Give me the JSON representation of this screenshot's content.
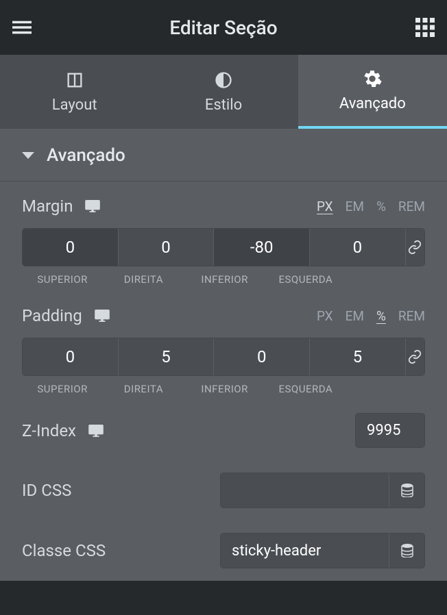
{
  "header": {
    "title": "Editar Seção"
  },
  "tabs": [
    {
      "label": "Layout"
    },
    {
      "label": "Estilo"
    },
    {
      "label": "Avançado"
    }
  ],
  "section": {
    "title": "Avançado"
  },
  "margin": {
    "label": "Margin",
    "units": {
      "px": "PX",
      "em": "EM",
      "pct": "%",
      "rem": "REM"
    },
    "top": "0",
    "right": "0",
    "bottom": "-80",
    "left": "0",
    "sublabels": {
      "top": "SUPERIOR",
      "right": "DIREITA",
      "bottom": "INFERIOR",
      "left": "ESQUERDA"
    }
  },
  "padding": {
    "label": "Padding",
    "units": {
      "px": "PX",
      "em": "EM",
      "pct": "%",
      "rem": "REM"
    },
    "top": "0",
    "right": "5",
    "bottom": "0",
    "left": "5",
    "sublabels": {
      "top": "SUPERIOR",
      "right": "DIREITA",
      "bottom": "INFERIOR",
      "left": "ESQUERDA"
    }
  },
  "zindex": {
    "label": "Z-Index",
    "value": "9995"
  },
  "idcss": {
    "label": "ID CSS",
    "value": ""
  },
  "classecss": {
    "label": "Classe CSS",
    "value": "sticky-header"
  }
}
